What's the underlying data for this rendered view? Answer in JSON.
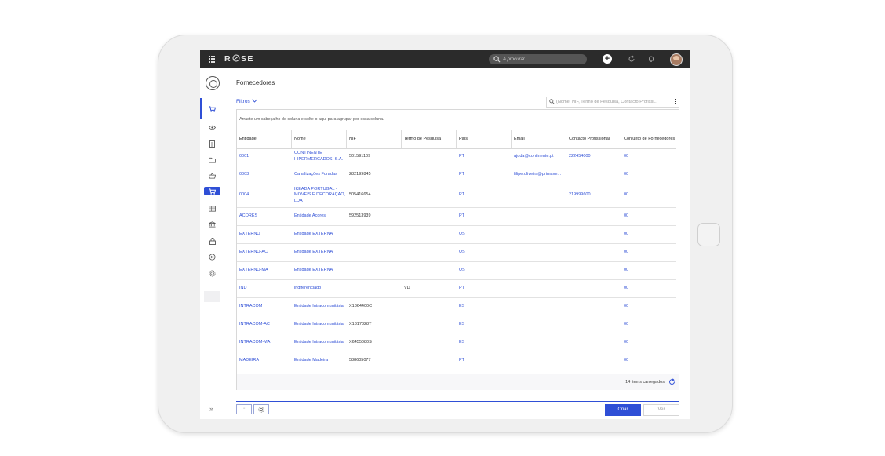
{
  "app": {
    "logo_text": "R SE",
    "search_placeholder": "A procurar ...",
    "new_label": "+"
  },
  "page": {
    "title": "Fornecedores",
    "filters_label": "Filtros",
    "filter_search_placeholder": "(Nome, NIF, Termo de Pesquisa, Contacto Profissi...",
    "group_hint": "Arraste um cabeçalho de coluna e solte-o aqui para agrupar por essa coluna.",
    "items_loaded": "14 items carregados"
  },
  "table": {
    "columns": [
      "Entidade",
      "Nome",
      "NIF",
      "Termo de Pesquisa",
      "País",
      "Email",
      "Contacto Profissional",
      "Conjunto de Fornecedores"
    ],
    "rows": [
      {
        "entidade": "0001",
        "nome": "CONTINENTE HIPERMERCADOS, S.A.",
        "nif": "501591109",
        "termo": "",
        "pais": "PT",
        "email": "ajuda@continente.pt",
        "contacto": "222454000",
        "conjunto": "00"
      },
      {
        "entidade": "0003",
        "nome": "Canalizações Furadas",
        "nif": "282199845",
        "termo": "",
        "pais": "PT",
        "email": "filipe.oliveira@primave...",
        "contacto": "",
        "conjunto": "00"
      },
      {
        "entidade": "0004",
        "nome": "IKEADA PORTUGAL - MÓVEIS E DECORAÇÃO, LDA",
        "nif": "505416654",
        "termo": "",
        "pais": "PT",
        "email": "",
        "contacto": "219999600",
        "conjunto": "00"
      },
      {
        "entidade": "ACORES",
        "nome": "Entidade Açores",
        "nif": "592513939",
        "termo": "",
        "pais": "PT",
        "email": "",
        "contacto": "",
        "conjunto": "00"
      },
      {
        "entidade": "EXTERNO",
        "nome": "Entidade EXTERNA",
        "nif": "",
        "termo": "",
        "pais": "US",
        "email": "",
        "contacto": "",
        "conjunto": "00"
      },
      {
        "entidade": "EXTERNO-AC",
        "nome": "Entidade EXTERNA",
        "nif": "",
        "termo": "",
        "pais": "US",
        "email": "",
        "contacto": "",
        "conjunto": "00"
      },
      {
        "entidade": "EXTERNO-MA",
        "nome": "Entidade EXTERNA",
        "nif": "",
        "termo": "",
        "pais": "US",
        "email": "",
        "contacto": "",
        "conjunto": "00"
      },
      {
        "entidade": "IND",
        "nome": "indiferenciado",
        "nif": "",
        "termo": "VD",
        "pais": "PT",
        "email": "",
        "contacto": "",
        "conjunto": "00"
      },
      {
        "entidade": "INTRACOM",
        "nome": "Entidade Intracomunitária",
        "nif": "X1864400C",
        "termo": "",
        "pais": "ES",
        "email": "",
        "contacto": "",
        "conjunto": "00"
      },
      {
        "entidade": "INTRACOM-AC",
        "nome": "Entidade Intracomunitária",
        "nif": "X1817828T",
        "termo": "",
        "pais": "ES",
        "email": "",
        "contacto": "",
        "conjunto": "00"
      },
      {
        "entidade": "INTRACOM-MA",
        "nome": "Entidade Intracomunitária",
        "nif": "X6455080S",
        "termo": "",
        "pais": "ES",
        "email": "",
        "contacto": "",
        "conjunto": "00"
      },
      {
        "entidade": "MADEIRA",
        "nome": "Entidade Madeira",
        "nif": "588605077",
        "termo": "",
        "pais": "PT",
        "email": "",
        "contacto": "",
        "conjunto": "00"
      }
    ]
  },
  "actions": {
    "more_label": "···",
    "settings_icon": "gear-icon",
    "create_label": "Criar",
    "view_label": "Ver"
  },
  "colors": {
    "accent": "#2f4fd6",
    "topbar": "#2b2b2b"
  }
}
